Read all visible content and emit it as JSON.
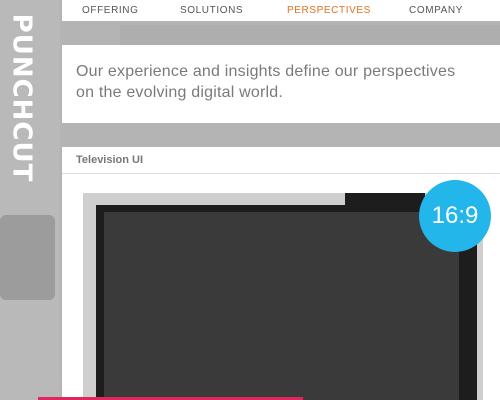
{
  "brand": {
    "logo_text": "PUNCHCUT"
  },
  "nav": {
    "items": [
      {
        "label": "OFFERING",
        "active": false
      },
      {
        "label": "SOLUTIONS",
        "active": false
      },
      {
        "label": "PERSPECTIVES",
        "active": true
      },
      {
        "label": "COMPANY",
        "active": false
      }
    ]
  },
  "intro": {
    "line1": "Our experience and insights define our perspectives",
    "line2": "on the evolving digital world."
  },
  "section": {
    "title": "Television UI",
    "aspect_badge": "16:9"
  },
  "colors": {
    "accent_active": "#e0711e",
    "badge": "#22b6ea",
    "bottom_bar": "#e0265f"
  }
}
